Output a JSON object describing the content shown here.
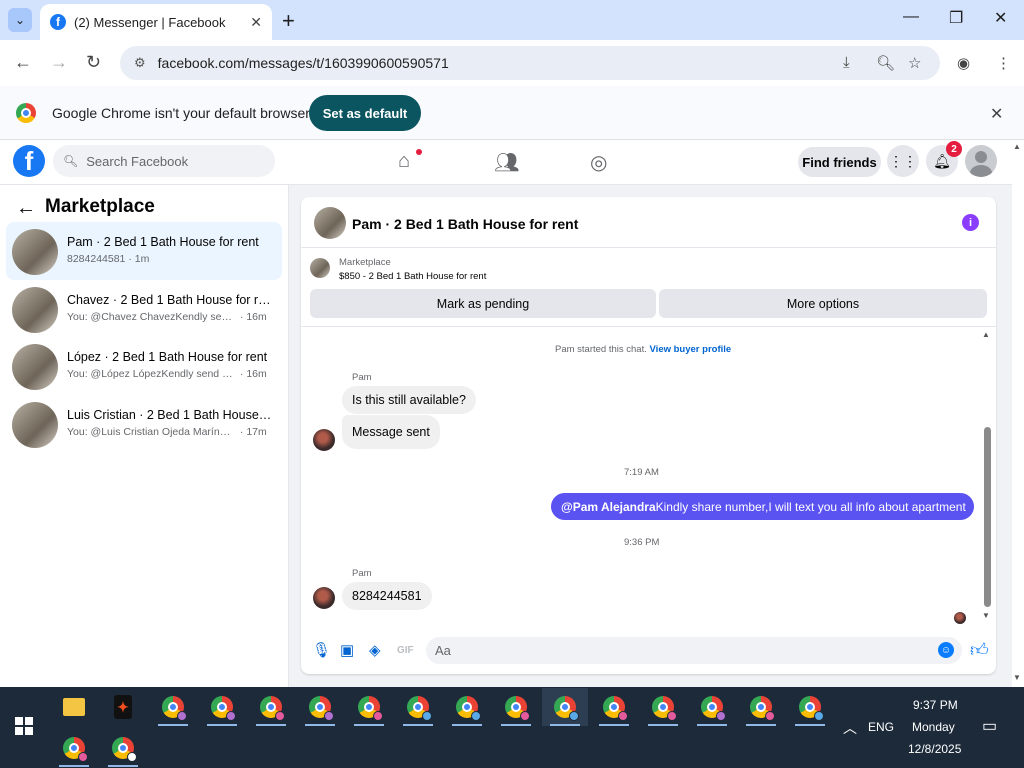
{
  "browser": {
    "tab_title": "(2) Messenger | Facebook",
    "url": "facebook.com/messages/t/1603990600590571",
    "infobar_text": "Google Chrome isn't your default browser",
    "set_default_label": "Set as default"
  },
  "facebook": {
    "search_placeholder": "Search Facebook",
    "find_friends_label": "Find friends",
    "notification_count": "2"
  },
  "sidebar": {
    "title": "Marketplace",
    "conversations": [
      {
        "name": "Pam · 2 Bed 1 Bath House for rent",
        "snippet": "8284244581",
        "time": "1m",
        "active": true
      },
      {
        "name": "Chavez · 2 Bed 1 Bath House for rent",
        "snippet": "You: @Chavez ChavezKendly send n...",
        "time": "16m"
      },
      {
        "name": "López · 2 Bed 1 Bath House for rent",
        "snippet": "You: @López LópezKendly send nu...",
        "time": "16m"
      },
      {
        "name": "Luis Cristian · 2 Bed 1 Bath House f...",
        "snippet": "You: @Luis Cristian Ojeda MarínKin...",
        "time": "17m"
      }
    ]
  },
  "chat": {
    "title": "Pam · 2 Bed 1 Bath House for rent",
    "listing_source": "Marketplace",
    "listing_title": "$850 - 2 Bed 1 Bath House for rent",
    "mark_pending_label": "Mark as pending",
    "more_options_label": "More options",
    "started_text": "Pam started this chat.",
    "view_profile_label": "View buyer profile",
    "sender_1": "Pam",
    "msg_1": "Is this still available?",
    "msg_2": "Message sent",
    "time_1": "7:19 AM",
    "out_mention": "@Pam Alejandra",
    "out_text": "Kindly share number,I will text you all info about apartment",
    "time_2": "9:36 PM",
    "sender_2": "Pam",
    "msg_3": "8284244581",
    "compose_placeholder": "Aa"
  },
  "taskbar": {
    "lang": "ENG",
    "time": "9:37 PM",
    "day": "Monday",
    "date": "12/8/2025"
  }
}
